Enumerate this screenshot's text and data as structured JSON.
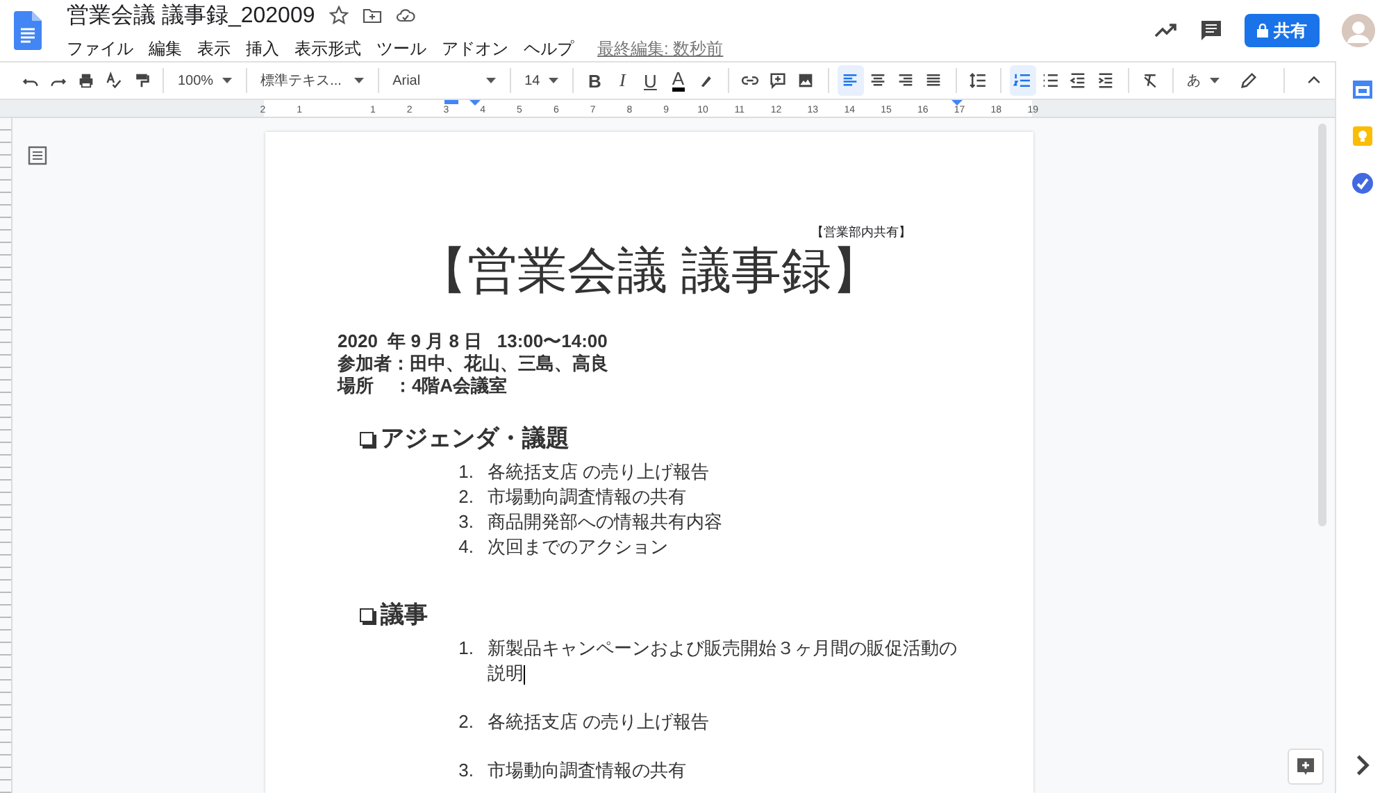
{
  "header": {
    "title": "営業会議 議事録_202009",
    "menu": [
      "ファイル",
      "編集",
      "表示",
      "挿入",
      "表示形式",
      "ツール",
      "アドオン",
      "ヘルプ"
    ],
    "last_edit": "最終編集: 数秒前",
    "share_label": "共有"
  },
  "toolbar": {
    "dropdowns": [
      "100%",
      "標準テキス...",
      "Arial",
      "14"
    ],
    "format_buttons": [
      "B",
      "I",
      "U",
      "A"
    ],
    "alignment": [
      {
        "selected": true
      },
      {
        "selected": false
      },
      {
        "selected": false
      },
      {
        "selected": false
      }
    ],
    "lists": [
      {
        "selected": true
      },
      {
        "selected": false
      }
    ],
    "input_mode": "あ"
  },
  "ruler": {
    "marks": [
      "2",
      "1",
      "1",
      "2",
      "3",
      "4",
      "5",
      "6",
      "7",
      "8",
      "9",
      "10",
      "11",
      "12",
      "13",
      "14",
      "15",
      "16",
      "17",
      "18",
      "19"
    ]
  },
  "document": {
    "note": "【営業部内共有】",
    "title": "【営業会議 議事録】",
    "meta": [
      "2020  年 9 月 8 日   13:00〜14:00",
      "参加者：田中、花山、三島、高良",
      "場所    ：4階A会議室"
    ],
    "sections": [
      {
        "heading": "アジェンダ・議題",
        "items": [
          {
            "number": "1.",
            "text": "各統括支店 の売り上げ報告",
            "cursor": false
          },
          {
            "number": "2.",
            "text": "市場動向調査情報の共有",
            "cursor": false
          },
          {
            "number": "3.",
            "text": "商品開発部への情報共有内容",
            "cursor": false
          },
          {
            "number": "4.",
            "text": "次回までのアクション",
            "cursor": false
          }
        ]
      },
      {
        "heading": "議事",
        "items": [
          {
            "number": "1.",
            "text": "新製品キャンペーンおよび販売開始３ヶ月間の販促活動の説明",
            "cursor": true
          },
          {
            "number": "2.",
            "text": "各統括支店 の売り上げ報告",
            "cursor": false
          },
          {
            "number": "3.",
            "text": "市場動向調査情報の共有",
            "cursor": false
          }
        ]
      }
    ]
  }
}
